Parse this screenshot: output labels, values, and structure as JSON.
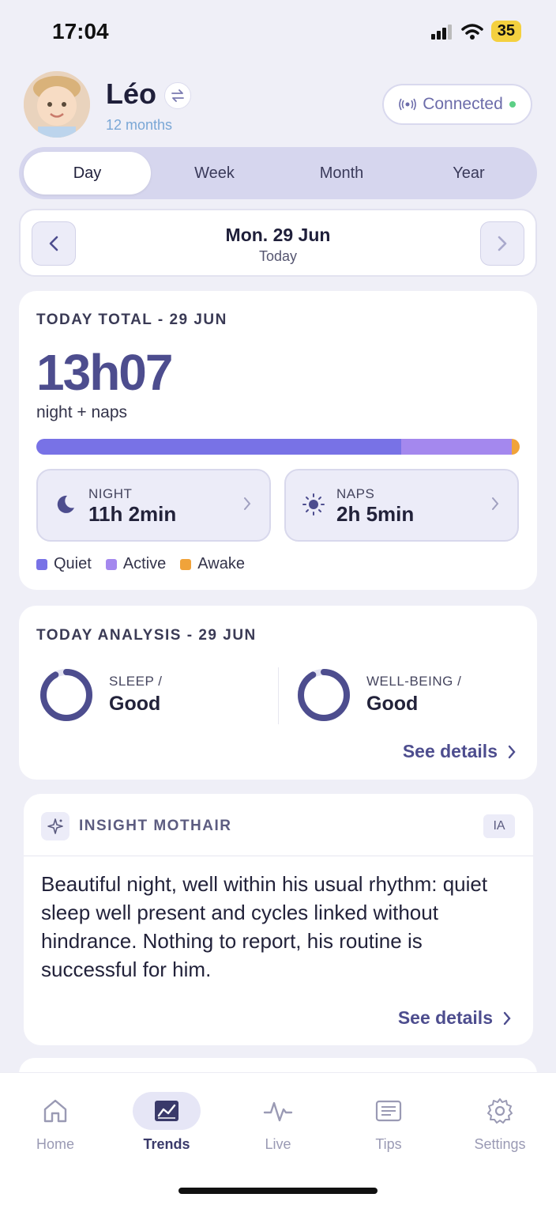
{
  "status_bar": {
    "time": "17:04",
    "battery": "35"
  },
  "profile": {
    "name": "Léo",
    "age": "12 months",
    "connection": "Connected"
  },
  "tabs": [
    {
      "label": "Day"
    },
    {
      "label": "Week"
    },
    {
      "label": "Month"
    },
    {
      "label": "Year"
    }
  ],
  "date_nav": {
    "date": "Mon. 29 Jun",
    "relative": "Today"
  },
  "total_card": {
    "label": "TODAY TOTAL - 29 JUN",
    "value": "13h07",
    "subtitle": "night + naps",
    "bar_fractions": {
      "quiet": 0.755,
      "active": 0.228,
      "awake": 0.017
    },
    "night": {
      "label": "NIGHT",
      "value": "11h 2min"
    },
    "naps": {
      "label": "NAPS",
      "value": "2h 5min"
    },
    "legend": [
      {
        "label": "Quiet",
        "color": "#7872e6"
      },
      {
        "label": "Active",
        "color": "#a488ee"
      },
      {
        "label": "Awake",
        "color": "#f0a33a"
      }
    ]
  },
  "analysis_card": {
    "label": "TODAY ANALYSIS - 29 JUN",
    "sleep": {
      "kicker": "SLEEP /",
      "value": "Good",
      "score_fraction": 0.92
    },
    "wellbeing": {
      "kicker": "WELL-BEING /",
      "value": "Good",
      "score_fraction": 0.92
    },
    "details": "See details"
  },
  "insight_card": {
    "title": "INSIGHT MOTHAIR",
    "badge": "IA",
    "text": "Beautiful night, well within his usual rhythm: quiet sleep well present and cycles linked without hindrance. Nothing to report, his routine is successful for him.",
    "details": "See details"
  },
  "bottom_nav": [
    {
      "label": "Home",
      "icon": "home-icon"
    },
    {
      "label": "Trends",
      "icon": "trends-icon",
      "active": true
    },
    {
      "label": "Live",
      "icon": "pulse-icon"
    },
    {
      "label": "Tips",
      "icon": "tips-icon"
    },
    {
      "label": "Settings",
      "icon": "gear-icon"
    }
  ],
  "colors": {
    "accent": "#4d4d8e",
    "background": "#efeff7",
    "connected_dot": "#5ccf86"
  }
}
